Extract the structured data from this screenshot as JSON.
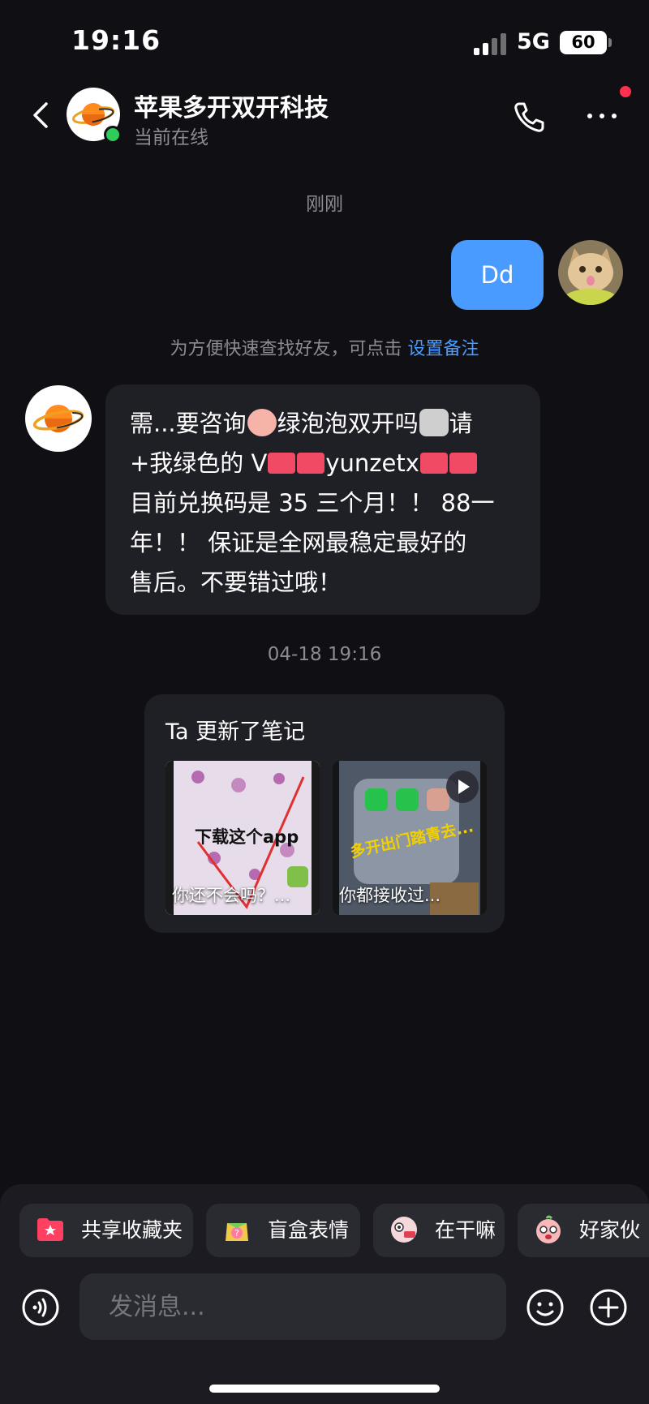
{
  "status_bar": {
    "time": "19:16",
    "network": "5G",
    "battery": "60"
  },
  "header": {
    "contact_name": "苹果多开双开科技",
    "contact_status": "当前在线"
  },
  "messages": {
    "time_separator_1": "刚刚",
    "my_message": "Dd",
    "notice_text": "为方便快速查找好友，可点击 ",
    "notice_link": "设置备注",
    "their_message_lines": [
      {
        "a": "需...要咨询",
        "b": "绿泡泡双开吗",
        "c": "请"
      },
      {
        "a": "+我绿色的 V",
        "b": "yunzetx"
      },
      {
        "a": "目前兑换码是 35 三个月！！ 88一"
      },
      {
        "a": "年！！ 保证是全网最稳定最好的"
      },
      {
        "a": "售后。不要错过哦！"
      }
    ],
    "time_separator_2": "04-18 19:16"
  },
  "note_card": {
    "title": "Ta 更新了笔记",
    "thumb1": {
      "overlay": "下载这个app",
      "caption": "你还不会吗？..."
    },
    "thumb2": {
      "overlay": "多开出门踏青去...",
      "caption": "你都接收过..."
    }
  },
  "quick_chips": [
    {
      "label": "共享收藏夹",
      "icon": "folder-star-icon"
    },
    {
      "label": "盲盒表情",
      "icon": "blind-box-icon"
    },
    {
      "label": "在干嘛",
      "icon": "sticker-icon"
    },
    {
      "label": "好家伙",
      "icon": "sticker-icon"
    }
  ],
  "input": {
    "placeholder": "发消息..."
  },
  "colors": {
    "background": "#0f0f14",
    "accent": "#4a9bff",
    "online": "#2ecc5a",
    "badge": "#ff3050",
    "bubble": "#1f1f26"
  }
}
